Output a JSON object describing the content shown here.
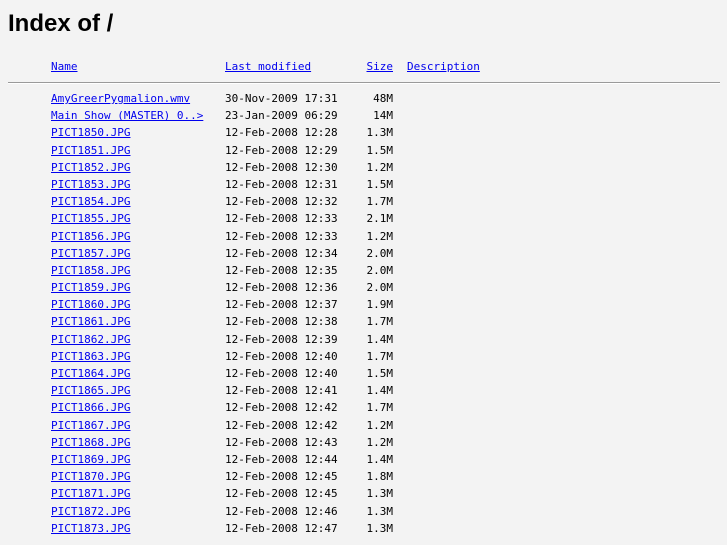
{
  "page": {
    "title": "Index of /"
  },
  "columns": {
    "name": "Name",
    "modified": "Last modified",
    "size": "Size",
    "description": "Description"
  },
  "files": [
    {
      "name": "AmyGreerPygmalion.wmv",
      "modified": "30-Nov-2009 17:31",
      "size": "48M"
    },
    {
      "name": "Main Show (MASTER) 0..>",
      "modified": "23-Jan-2009 06:29",
      "size": "14M"
    },
    {
      "name": "PICT1850.JPG",
      "modified": "12-Feb-2008 12:28",
      "size": "1.3M"
    },
    {
      "name": "PICT1851.JPG",
      "modified": "12-Feb-2008 12:29",
      "size": "1.5M"
    },
    {
      "name": "PICT1852.JPG",
      "modified": "12-Feb-2008 12:30",
      "size": "1.2M"
    },
    {
      "name": "PICT1853.JPG",
      "modified": "12-Feb-2008 12:31",
      "size": "1.5M"
    },
    {
      "name": "PICT1854.JPG",
      "modified": "12-Feb-2008 12:32",
      "size": "1.7M"
    },
    {
      "name": "PICT1855.JPG",
      "modified": "12-Feb-2008 12:33",
      "size": "2.1M"
    },
    {
      "name": "PICT1856.JPG",
      "modified": "12-Feb-2008 12:33",
      "size": "1.2M"
    },
    {
      "name": "PICT1857.JPG",
      "modified": "12-Feb-2008 12:34",
      "size": "2.0M"
    },
    {
      "name": "PICT1858.JPG",
      "modified": "12-Feb-2008 12:35",
      "size": "2.0M"
    },
    {
      "name": "PICT1859.JPG",
      "modified": "12-Feb-2008 12:36",
      "size": "2.0M"
    },
    {
      "name": "PICT1860.JPG",
      "modified": "12-Feb-2008 12:37",
      "size": "1.9M"
    },
    {
      "name": "PICT1861.JPG",
      "modified": "12-Feb-2008 12:38",
      "size": "1.7M"
    },
    {
      "name": "PICT1862.JPG",
      "modified": "12-Feb-2008 12:39",
      "size": "1.4M"
    },
    {
      "name": "PICT1863.JPG",
      "modified": "12-Feb-2008 12:40",
      "size": "1.7M"
    },
    {
      "name": "PICT1864.JPG",
      "modified": "12-Feb-2008 12:40",
      "size": "1.5M"
    },
    {
      "name": "PICT1865.JPG",
      "modified": "12-Feb-2008 12:41",
      "size": "1.4M"
    },
    {
      "name": "PICT1866.JPG",
      "modified": "12-Feb-2008 12:42",
      "size": "1.7M"
    },
    {
      "name": "PICT1867.JPG",
      "modified": "12-Feb-2008 12:42",
      "size": "1.2M"
    },
    {
      "name": "PICT1868.JPG",
      "modified": "12-Feb-2008 12:43",
      "size": "1.2M"
    },
    {
      "name": "PICT1869.JPG",
      "modified": "12-Feb-2008 12:44",
      "size": "1.4M"
    },
    {
      "name": "PICT1870.JPG",
      "modified": "12-Feb-2008 12:45",
      "size": "1.8M"
    },
    {
      "name": "PICT1871.JPG",
      "modified": "12-Feb-2008 12:45",
      "size": "1.3M"
    },
    {
      "name": "PICT1872.JPG",
      "modified": "12-Feb-2008 12:46",
      "size": "1.3M"
    },
    {
      "name": "PICT1873.JPG",
      "modified": "12-Feb-2008 12:47",
      "size": "1.3M"
    }
  ]
}
